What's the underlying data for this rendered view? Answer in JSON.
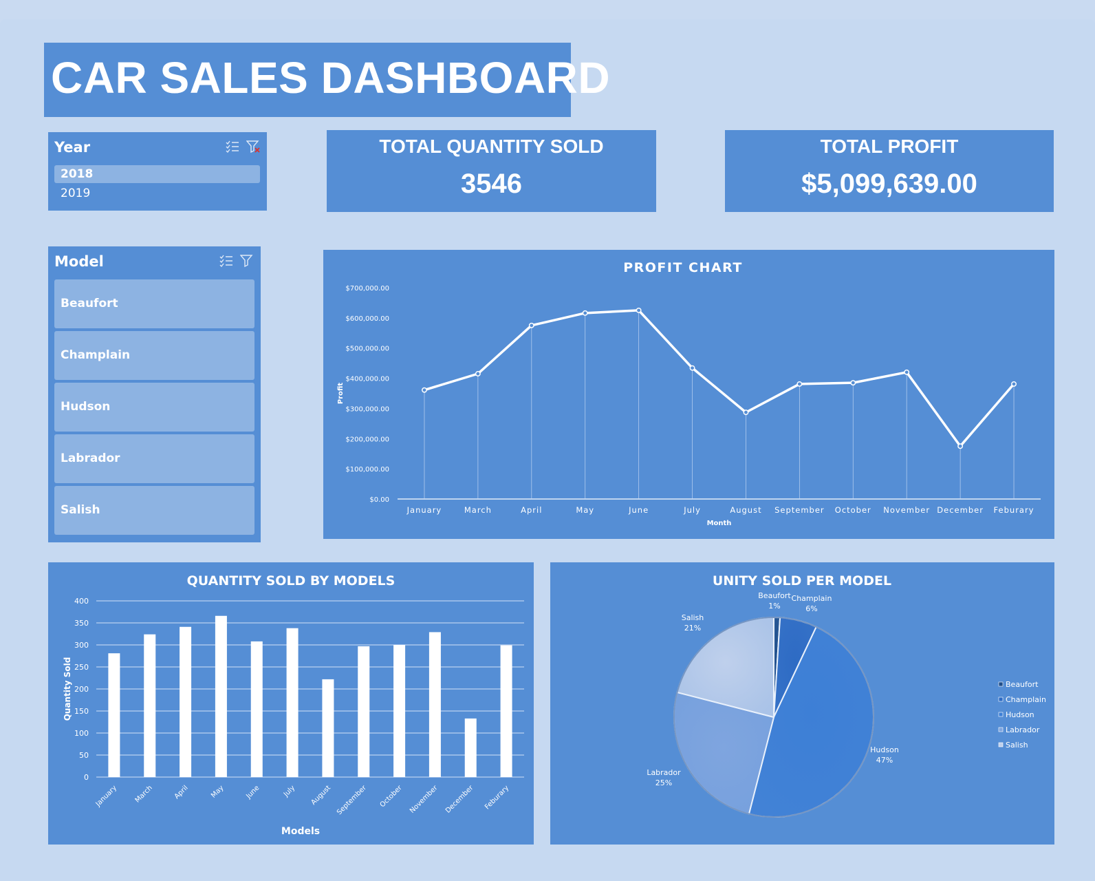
{
  "title": "CAR SALES DASHBOARD",
  "year_slicer": {
    "title": "Year",
    "items": [
      {
        "label": "2018",
        "selected": true
      },
      {
        "label": "2019",
        "selected": false
      }
    ]
  },
  "model_slicer": {
    "title": "Model",
    "items": [
      "Beaufort",
      "Champlain",
      "Hudson",
      "Labrador",
      "Salish"
    ]
  },
  "kpis": {
    "quantity_label": "TOTAL QUANTITY SOLD",
    "quantity_value": "3546",
    "profit_label": "TOTAL PROFIT",
    "profit_value": "$5,099,639.00"
  },
  "colors": {
    "background": "#c6d9f1",
    "panel": "#558ed5",
    "slicer_item": "#8db3e2",
    "white": "#ffffff"
  },
  "chart_data": [
    {
      "id": "profit",
      "type": "line",
      "title": "PROFIT CHART",
      "xlabel": "Month",
      "ylabel": "Profit",
      "categories": [
        "January",
        "March",
        "April",
        "May",
        "June",
        "July",
        "August",
        "September",
        "October",
        "November",
        "December",
        "Feburary"
      ],
      "series": [
        {
          "values": [
            361000,
            415000,
            575000,
            616000,
            625000,
            434000,
            287000,
            381000,
            385000,
            420000,
            175000,
            381000
          ]
        }
      ],
      "ylim": [
        0,
        700000
      ],
      "yticks": [
        "$0.00",
        "$100,000.00",
        "$200,000.00",
        "$300,000.00",
        "$400,000.00",
        "$500,000.00",
        "$600,000.00",
        "$700,000.00"
      ],
      "grid": false
    },
    {
      "id": "quantity",
      "type": "bar",
      "title": "QUANTITY SOLD BY MODELS",
      "xlabel": "Models",
      "ylabel": "Quantity Sold",
      "categories": [
        "January",
        "March",
        "April",
        "May",
        "June",
        "July",
        "August",
        "September",
        "October",
        "November",
        "December",
        "Feburary"
      ],
      "values": [
        281,
        324,
        341,
        366,
        308,
        338,
        222,
        297,
        300,
        329,
        133,
        299
      ],
      "ylim": [
        0,
        400
      ],
      "yticks": [
        "0",
        "50",
        "100",
        "150",
        "200",
        "250",
        "300",
        "350",
        "400"
      ],
      "grid": true
    },
    {
      "id": "units",
      "type": "pie",
      "title": "UNITY SOLD PER MODEL",
      "slices": [
        {
          "label": "Beaufort",
          "pct_label": "1%",
          "value": 1,
          "color": "#1f4e8a"
        },
        {
          "label": "Champlain",
          "pct_label": "6%",
          "value": 6,
          "color": "#2e6bc4"
        },
        {
          "label": "Hudson",
          "pct_label": "47%",
          "value": 47,
          "color": "#3d7fd6"
        },
        {
          "label": "Labrador",
          "pct_label": "25%",
          "value": 25,
          "color": "#7fa5df"
        },
        {
          "label": "Salish",
          "pct_label": "21%",
          "value": 21,
          "color": "#bfd0ec"
        }
      ],
      "legend": "right"
    }
  ]
}
